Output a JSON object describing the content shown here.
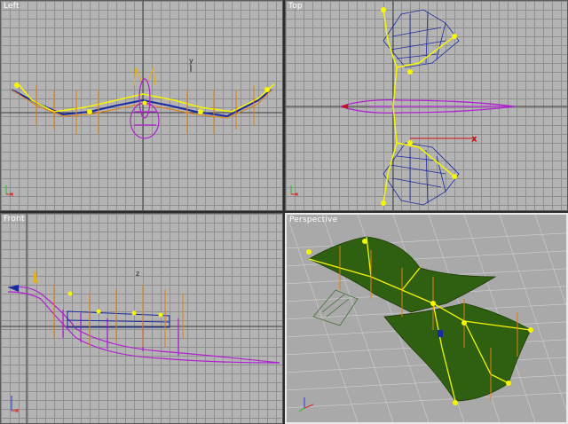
{
  "viewports": {
    "left": {
      "label": "Left"
    },
    "top": {
      "label": "Top"
    },
    "front": {
      "label": "Front"
    },
    "perspective": {
      "label": "Perspective"
    }
  },
  "axis_labels": {
    "x": "x",
    "y": "y",
    "z": "z"
  },
  "colors": {
    "viewport_bg": "#b4b4b4",
    "grid_line": "#8f8f8f",
    "axis_line": "#3c3c3c",
    "bone_yellow": "#f6f600",
    "wing_mesh_blue": "#1a2aa0",
    "body_mesh_magenta": "#b020d0",
    "bone_orange": "#e08010",
    "wing_membrane_green": "#2f5f10",
    "active_border": "#e8e8e8"
  }
}
